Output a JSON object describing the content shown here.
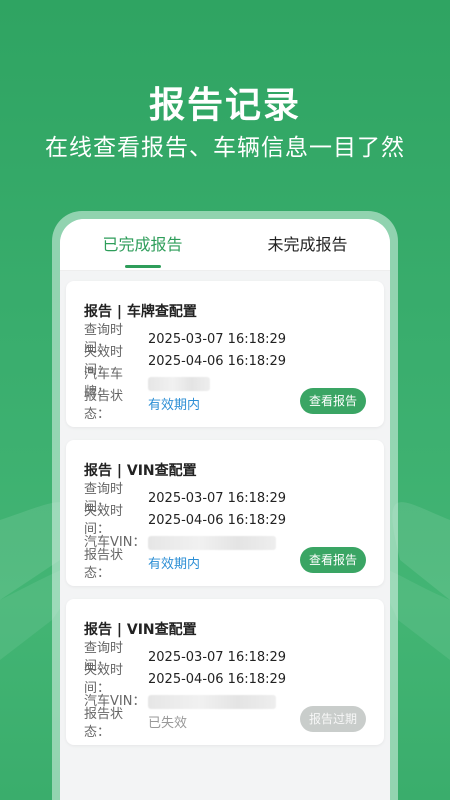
{
  "hero": {
    "title": "报告记录",
    "subtitle": "在线查看报告、车辆信息一目了然"
  },
  "tabs": [
    {
      "label": "已完成报告",
      "active": true
    },
    {
      "label": "未完成报告",
      "active": false
    }
  ],
  "cards": [
    {
      "title": "报告 | 车牌查配置",
      "query_label": "查询时间：",
      "query_time": "2025-03-07 16:18:29",
      "expire_label": "失效时间：",
      "expire_time": "2025-04-06 16:18:29",
      "vehicle_label": "汽车车牌：",
      "status_label": "报告状态：",
      "status": "有效期内",
      "button": "查看报告"
    },
    {
      "title": "报告 | VIN查配置",
      "query_label": "查询时间：",
      "query_time": "2025-03-07 16:18:29",
      "expire_label": "失效时间：",
      "expire_time": "2025-04-06 16:18:29",
      "vehicle_label": "汽车VIN：",
      "status_label": "报告状态：",
      "status": "有效期内",
      "button": "查看报告"
    },
    {
      "title": "报告 | VIN查配置",
      "query_label": "查询时间：",
      "query_time": "2025-03-07 16:18:29",
      "expire_label": "失效时间：",
      "expire_time": "2025-04-06 16:18:29",
      "vehicle_label": "汽车VIN：",
      "status_label": "报告状态：",
      "status": "已失效",
      "button": "报告过期"
    }
  ],
  "colors": {
    "brand_green": "#2e9d5a",
    "button_green": "#3aa564",
    "status_valid": "#2d8fd5",
    "status_expired": "#999999"
  }
}
